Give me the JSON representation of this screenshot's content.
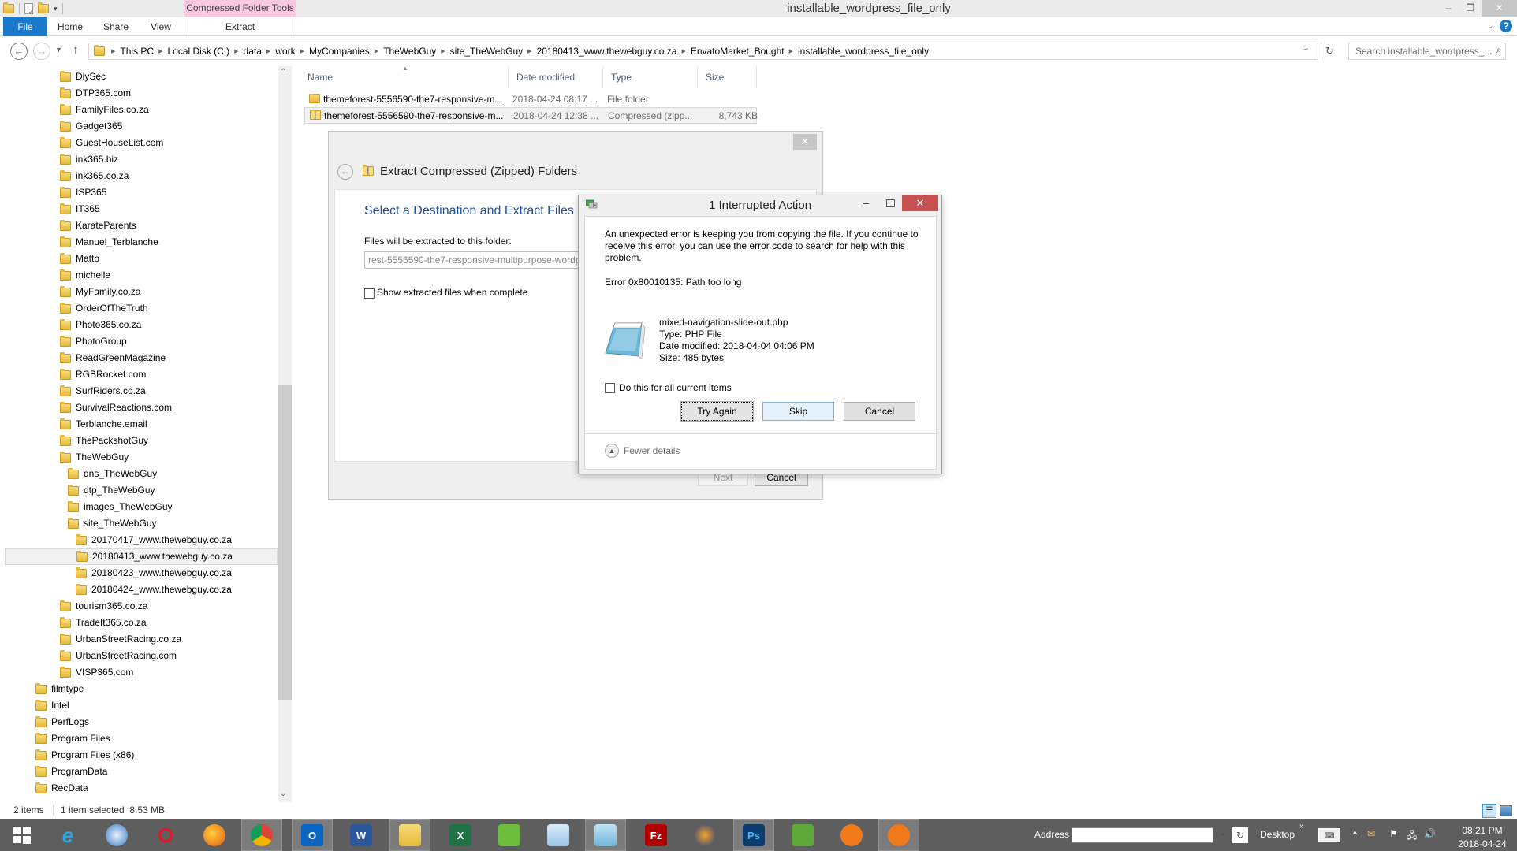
{
  "window": {
    "title": "installable_wordpress_file_only",
    "contextual_tab_group": "Compressed Folder Tools",
    "controls": {
      "minimize": "–",
      "restore": "❐",
      "close": "✕"
    }
  },
  "ribbon": {
    "tabs": [
      {
        "label": "File",
        "active": true
      },
      {
        "label": "Home"
      },
      {
        "label": "Share"
      },
      {
        "label": "View"
      },
      {
        "label": "Extract"
      }
    ],
    "expand_icon": "chevron-down-icon",
    "help_label": "?"
  },
  "navigation": {
    "breadcrumb": [
      "This PC",
      "Local Disk (C:)",
      "data",
      "work",
      "MyCompanies",
      "TheWebGuy",
      "site_TheWebGuy",
      "20180413_www.thewebguy.co.za",
      "EnvatoMarket_Bought",
      "installable_wordpress_file_only"
    ],
    "search_placeholder": "Search installable_wordpress_..."
  },
  "tree": {
    "items": [
      {
        "label": "DiySec",
        "level": 2
      },
      {
        "label": "DTP365.com",
        "level": 2
      },
      {
        "label": "FamilyFiles.co.za",
        "level": 2
      },
      {
        "label": "Gadget365",
        "level": 2
      },
      {
        "label": "GuestHouseList.com",
        "level": 2
      },
      {
        "label": "ink365.biz",
        "level": 2
      },
      {
        "label": "ink365.co.za",
        "level": 2
      },
      {
        "label": "ISP365",
        "level": 2
      },
      {
        "label": "IT365",
        "level": 2
      },
      {
        "label": "KarateParents",
        "level": 2
      },
      {
        "label": "Manuel_Terblanche",
        "level": 2
      },
      {
        "label": "Matto",
        "level": 2
      },
      {
        "label": "michelle",
        "level": 2
      },
      {
        "label": "MyFamily.co.za",
        "level": 2
      },
      {
        "label": "OrderOfTheTruth",
        "level": 2
      },
      {
        "label": "Photo365.co.za",
        "level": 2
      },
      {
        "label": "PhotoGroup",
        "level": 2
      },
      {
        "label": "ReadGreenMagazine",
        "level": 2
      },
      {
        "label": "RGBRocket.com",
        "level": 2
      },
      {
        "label": "SurfRiders.co.za",
        "level": 2
      },
      {
        "label": "SurvivalReactions.com",
        "level": 2
      },
      {
        "label": "Terblanche.email",
        "level": 2
      },
      {
        "label": "ThePackshotGuy",
        "level": 2
      },
      {
        "label": "TheWebGuy",
        "level": 2
      },
      {
        "label": "dns_TheWebGuy",
        "level": 3
      },
      {
        "label": "dtp_TheWebGuy",
        "level": 3
      },
      {
        "label": "images_TheWebGuy",
        "level": 3
      },
      {
        "label": "site_TheWebGuy",
        "level": 3
      },
      {
        "label": "20170417_www.thewebguy.co.za",
        "level": 4
      },
      {
        "label": "20180413_www.thewebguy.co.za",
        "level": 4,
        "selected": true
      },
      {
        "label": "20180423_www.thewebguy.co.za",
        "level": 4
      },
      {
        "label": "20180424_www.thewebguy.co.za",
        "level": 4
      },
      {
        "label": "tourism365.co.za",
        "level": 2
      },
      {
        "label": "TradeIt365.co.za",
        "level": 2
      },
      {
        "label": "UrbanStreetRacing.co.za",
        "level": 2
      },
      {
        "label": "UrbanStreetRacing.com",
        "level": 2
      },
      {
        "label": "VISP365.com",
        "level": 2
      },
      {
        "label": "filmtype",
        "level": 1
      },
      {
        "label": "Intel",
        "level": 1
      },
      {
        "label": "PerfLogs",
        "level": 1
      },
      {
        "label": "Program Files",
        "level": 1
      },
      {
        "label": "Program Files (x86)",
        "level": 1
      },
      {
        "label": "ProgramData",
        "level": 1
      },
      {
        "label": "RecData",
        "level": 1
      }
    ]
  },
  "filelist": {
    "columns": [
      "Name",
      "Date modified",
      "Type",
      "Size"
    ],
    "rows": [
      {
        "name": "themeforest-5556590-the7-responsive-m...",
        "date": "2018-04-24 08:17 ...",
        "type": "File folder",
        "size": "",
        "icon": "folder-icon"
      },
      {
        "name": "themeforest-5556590-the7-responsive-m...",
        "date": "2018-04-24 12:38 ...",
        "type": "Compressed (zipp...",
        "size": "8,743 KB",
        "icon": "zip-folder-icon",
        "selected": true
      }
    ]
  },
  "statusbar": {
    "item_count": "2 items",
    "selection": "1 item selected  8.53 MB"
  },
  "extract_wizard": {
    "title": "Extract Compressed (Zipped) Folders",
    "heading": "Select a Destination and Extract Files",
    "destination_label": "Files will be extracted to this folder:",
    "destination_value": "rest-5556590-the7-responsive-multipurpose-wordpress-theme",
    "show_files_label": "Show extracted files when complete",
    "show_files_checked": false,
    "next_label": "Next",
    "cancel_label": "Cancel",
    "close_label": "✕"
  },
  "interrupted_dialog": {
    "title": "1 Interrupted Action",
    "message": "An unexpected error is keeping you from copying the file. If you continue to receive this error, you can use the error code to search for help with this problem.",
    "error": "Error 0x80010135: Path too long",
    "file": {
      "name": "mixed-navigation-slide-out.php",
      "type": "Type: PHP File",
      "date_modified": "Date modified: 2018-04-04 04:06 PM",
      "size": "Size: 485 bytes"
    },
    "apply_all_label": "Do this for all current items",
    "apply_all_checked": false,
    "buttons": {
      "try_again": "Try Again",
      "skip": "Skip",
      "cancel": "Cancel"
    },
    "details_toggle": "Fewer details",
    "controls": {
      "minimize": "–",
      "close": "✕"
    }
  },
  "taskbar": {
    "apps": [
      {
        "name": "start",
        "label": ""
      },
      {
        "name": "internet-explorer",
        "label": "e"
      },
      {
        "name": "safari",
        "label": ""
      },
      {
        "name": "opera",
        "label": "O"
      },
      {
        "name": "firefox",
        "label": ""
      },
      {
        "name": "chrome",
        "label": "",
        "active": true
      },
      {
        "name": "outlook",
        "label": "O",
        "active": true
      },
      {
        "name": "word",
        "label": "W"
      },
      {
        "name": "file-explorer",
        "label": "",
        "active": true
      },
      {
        "name": "excel",
        "label": "X"
      },
      {
        "name": "green-app",
        "label": ""
      },
      {
        "name": "calculator",
        "label": ""
      },
      {
        "name": "notepad",
        "label": "",
        "active": true
      },
      {
        "name": "filezilla",
        "label": "Fz"
      },
      {
        "name": "media-app",
        "label": ""
      },
      {
        "name": "photoshop",
        "label": "Ps",
        "active": true
      },
      {
        "name": "coreldraw",
        "label": ""
      },
      {
        "name": "corel-app-1",
        "label": ""
      },
      {
        "name": "corel-app-2",
        "label": "",
        "active": true
      }
    ],
    "address_label": "Address",
    "address_value": "",
    "desktop_label": "Desktop",
    "clock_time": "08:21 PM",
    "clock_date": "2018-04-24"
  }
}
